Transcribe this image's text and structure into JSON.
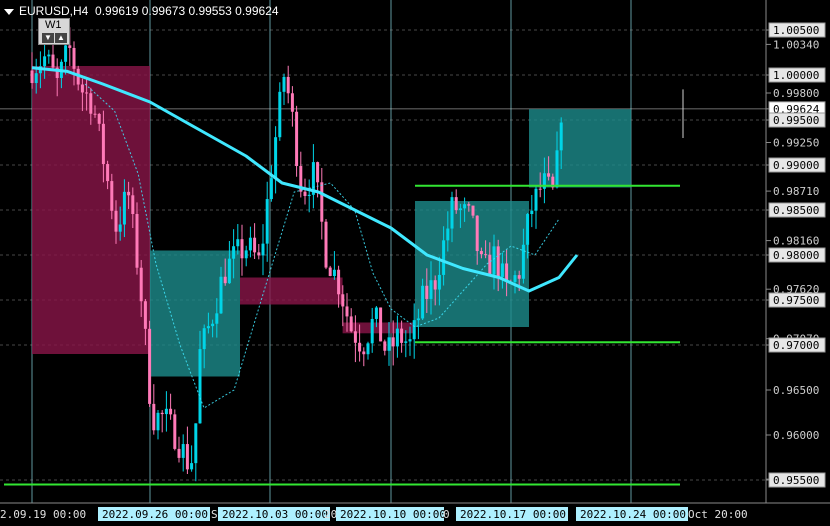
{
  "window": {
    "title": "EURUSD,H4",
    "ohlc": "0.99619 0.99673 0.99553 0.99624"
  },
  "widget": {
    "label": "W1",
    "down": "▼",
    "up": "▲"
  },
  "colors": {
    "background": "#000000",
    "bull": "#00d5e8",
    "bear": "#ff7ab8",
    "ma_fast": "#40e8ff",
    "support": "#32e632",
    "zone_bull": "#1d8c8c",
    "zone_bear": "#8a1548",
    "grid_h": "#a0a0a0",
    "grid_v": "#8fe0ea"
  },
  "price_axis": {
    "labels": [
      {
        "text": "1.00500",
        "price": 1.005,
        "boxed": true
      },
      {
        "text": "1.00340",
        "price": 1.0034,
        "boxed": false
      },
      {
        "text": "1.00000",
        "price": 1.0,
        "boxed": true
      },
      {
        "text": "0.99800",
        "price": 0.998,
        "boxed": false
      },
      {
        "text": "0.99624",
        "price": 0.99624,
        "boxed": true,
        "current": true
      },
      {
        "text": "0.99500",
        "price": 0.995,
        "boxed": true
      },
      {
        "text": "0.99250",
        "price": 0.9925,
        "boxed": false
      },
      {
        "text": "0.99000",
        "price": 0.99,
        "boxed": true
      },
      {
        "text": "0.98710",
        "price": 0.9871,
        "boxed": false
      },
      {
        "text": "0.98500",
        "price": 0.985,
        "boxed": true
      },
      {
        "text": "0.98160",
        "price": 0.9816,
        "boxed": false
      },
      {
        "text": "0.98000",
        "price": 0.98,
        "boxed": true
      },
      {
        "text": "0.97620",
        "price": 0.9762,
        "boxed": false
      },
      {
        "text": "0.97500",
        "price": 0.975,
        "boxed": true
      },
      {
        "text": "0.97070",
        "price": 0.9707,
        "boxed": false
      },
      {
        "text": "0.97000",
        "price": 0.97,
        "boxed": true
      },
      {
        "text": "0.96500",
        "price": 0.965,
        "boxed": false
      },
      {
        "text": "0.96000",
        "price": 0.96,
        "boxed": false
      },
      {
        "text": "0.95510",
        "price": 0.9551,
        "boxed": false
      },
      {
        "text": "0.95500",
        "price": 0.955,
        "boxed": true
      }
    ]
  },
  "time_axis": {
    "labels": [
      {
        "text": "2.09.19 00:00",
        "boxed": false
      },
      {
        "text": "2022.09.26 00:00",
        "boxed": true
      },
      {
        "text": "S",
        "boxed": false
      },
      {
        "text": "2022.10.03 00:00",
        "boxed": true
      },
      {
        "text": "20",
        "boxed": false
      },
      {
        "text": "2022.10.10 00:00",
        "boxed": true
      },
      {
        "text": "0",
        "boxed": false
      },
      {
        "text": "2022.10.17 00:00",
        "boxed": true
      },
      {
        "text": "2022.10.24 00:00",
        "boxed": true
      },
      {
        "text": "Oct 20:00",
        "boxed": false
      }
    ]
  },
  "chart_data": {
    "type": "candlestick",
    "symbol": "EURUSD",
    "timeframe": "H4",
    "ylim": [
      0.9535,
      1.0065
    ],
    "levels": [
      0.9545,
      0.9703,
      0.9877
    ],
    "zones": [
      {
        "kind": "bear",
        "x0": 0.0,
        "x1": 1.0,
        "y0": 0.969,
        "y1": 1.001
      },
      {
        "kind": "bull",
        "x0": 1.0,
        "x1": 1.75,
        "y0": 0.9665,
        "y1": 0.9805
      },
      {
        "kind": "bear",
        "x0": 1.75,
        "x1": 2.6,
        "y0": 0.9745,
        "y1": 0.9775
      },
      {
        "kind": "bear",
        "x0": 2.6,
        "x1": 3.2,
        "y0": 0.9713,
        "y1": 0.9725
      },
      {
        "kind": "bull",
        "x0": 3.2,
        "x1": 4.15,
        "y0": 0.972,
        "y1": 0.986
      },
      {
        "kind": "bull",
        "x0": 4.15,
        "x1": 5.0,
        "y0": 0.9875,
        "y1": 0.9962
      }
    ],
    "path": [
      [
        0.0,
        1.0005
      ],
      [
        0.15,
        1.002
      ],
      [
        0.25,
        0.999
      ],
      [
        0.35,
        1.003
      ],
      [
        0.45,
        0.9985
      ],
      [
        0.55,
        0.997
      ],
      [
        0.65,
        0.99
      ],
      [
        0.75,
        0.983
      ],
      [
        0.85,
        0.987
      ],
      [
        0.95,
        0.977
      ],
      [
        1.0,
        0.97
      ],
      [
        1.05,
        0.962
      ],
      [
        1.15,
        0.962
      ],
      [
        1.25,
        0.96
      ],
      [
        1.35,
        0.957
      ],
      [
        1.4,
        0.9575
      ],
      [
        1.45,
        0.969
      ],
      [
        1.55,
        0.973
      ],
      [
        1.65,
        0.978
      ],
      [
        1.75,
        0.98
      ],
      [
        1.85,
        0.981
      ],
      [
        1.95,
        0.979
      ],
      [
        2.05,
        0.99
      ],
      [
        2.15,
        1.0
      ],
      [
        2.2,
        0.997
      ],
      [
        2.3,
        0.987
      ],
      [
        2.4,
        0.989
      ],
      [
        2.5,
        0.98
      ],
      [
        2.6,
        0.977
      ],
      [
        2.7,
        0.972
      ],
      [
        2.8,
        0.97
      ],
      [
        2.9,
        0.973
      ],
      [
        3.0,
        0.969
      ],
      [
        3.1,
        0.971
      ],
      [
        3.2,
        0.97
      ],
      [
        3.3,
        0.975
      ],
      [
        3.4,
        0.977
      ],
      [
        3.55,
        0.9855
      ],
      [
        3.7,
        0.984
      ],
      [
        3.8,
        0.978
      ],
      [
        3.9,
        0.98
      ],
      [
        4.0,
        0.976
      ],
      [
        4.1,
        0.978
      ],
      [
        4.2,
        0.985
      ],
      [
        4.3,
        0.988
      ],
      [
        4.4,
        0.9865
      ],
      [
        4.45,
        0.9962
      ]
    ],
    "ma_slow": [
      [
        0.0,
        1.0008
      ],
      [
        0.3,
        1.0004
      ],
      [
        0.6,
        0.999
      ],
      [
        1.0,
        0.997
      ],
      [
        1.4,
        0.994
      ],
      [
        1.8,
        0.991
      ],
      [
        2.1,
        0.988
      ],
      [
        2.4,
        0.987
      ],
      [
        2.7,
        0.985
      ],
      [
        3.0,
        0.983
      ],
      [
        3.3,
        0.98
      ],
      [
        3.6,
        0.9785
      ],
      [
        3.9,
        0.9775
      ],
      [
        4.15,
        0.976
      ],
      [
        4.4,
        0.9775
      ],
      [
        4.55,
        0.98
      ]
    ],
    "ma_dotted": [
      [
        0.45,
        0.999
      ],
      [
        0.7,
        0.996
      ],
      [
        0.9,
        0.989
      ],
      [
        1.05,
        0.979
      ],
      [
        1.25,
        0.97
      ],
      [
        1.45,
        0.963
      ],
      [
        1.7,
        0.965
      ],
      [
        1.95,
        0.976
      ],
      [
        2.2,
        0.987
      ],
      [
        2.5,
        0.988
      ],
      [
        2.7,
        0.985
      ],
      [
        2.85,
        0.978
      ],
      [
        3.0,
        0.974
      ],
      [
        3.2,
        0.972
      ],
      [
        3.4,
        0.973
      ],
      [
        3.6,
        0.976
      ],
      [
        3.8,
        0.979
      ],
      [
        4.0,
        0.981
      ],
      [
        4.2,
        0.98
      ],
      [
        4.4,
        0.984
      ]
    ]
  }
}
